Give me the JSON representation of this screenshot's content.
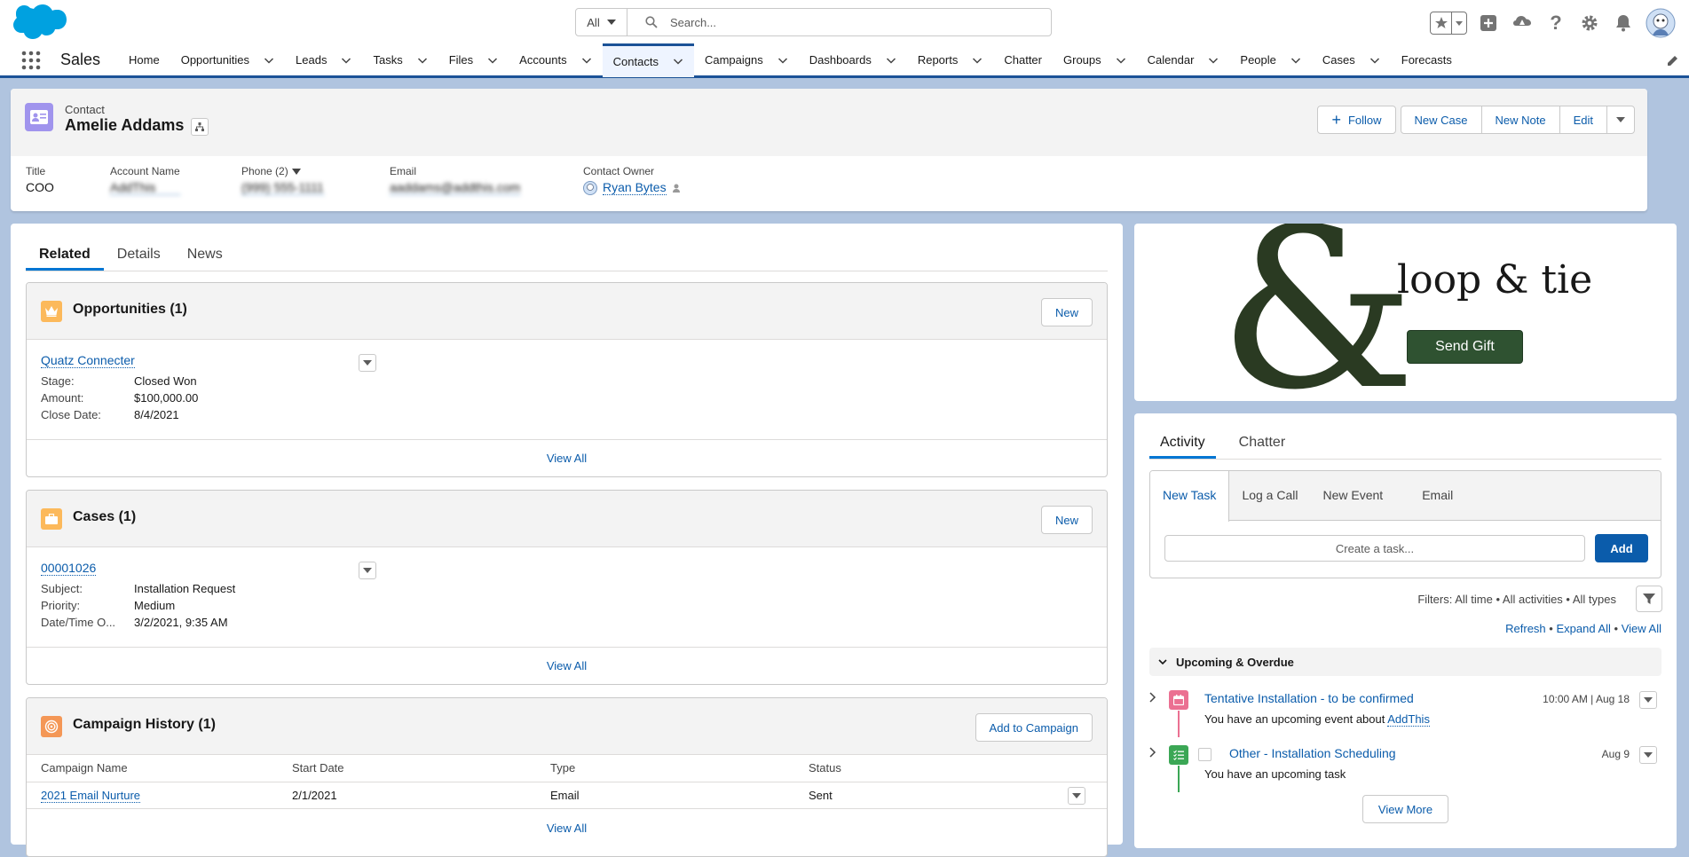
{
  "header": {
    "search_scope": "All",
    "search_placeholder": "Search..."
  },
  "nav": {
    "app_name": "Sales",
    "items": [
      {
        "label": "Home",
        "menu": false
      },
      {
        "label": "Opportunities",
        "menu": true
      },
      {
        "label": "Leads",
        "menu": true
      },
      {
        "label": "Tasks",
        "menu": true
      },
      {
        "label": "Files",
        "menu": true
      },
      {
        "label": "Accounts",
        "menu": true
      },
      {
        "label": "Contacts",
        "menu": true,
        "active": true
      },
      {
        "label": "Campaigns",
        "menu": true
      },
      {
        "label": "Dashboards",
        "menu": true
      },
      {
        "label": "Reports",
        "menu": true
      },
      {
        "label": "Chatter",
        "menu": false
      },
      {
        "label": "Groups",
        "menu": true
      },
      {
        "label": "Calendar",
        "menu": true
      },
      {
        "label": "People",
        "menu": true
      },
      {
        "label": "Cases",
        "menu": true
      },
      {
        "label": "Forecasts",
        "menu": false
      }
    ]
  },
  "record": {
    "type_label": "Contact",
    "name": "Amelie Addams",
    "actions": {
      "follow": "Follow",
      "new_case": "New Case",
      "new_note": "New Note",
      "edit": "Edit"
    },
    "fields": {
      "title_label": "Title",
      "title_value": "COO",
      "account_label": "Account Name",
      "account_value": "AddThis",
      "phone_label": "Phone (2)",
      "phone_value": "(999) 555-1111",
      "email_label": "Email",
      "email_value": "aaddams@addthis.com",
      "owner_label": "Contact Owner",
      "owner_value": "Ryan Bytes"
    }
  },
  "main_tabs": {
    "related": "Related",
    "details": "Details",
    "news": "News"
  },
  "opportunities": {
    "title": "Opportunities (1)",
    "new_label": "New",
    "record_name": "Quatz Connecter",
    "stage_label": "Stage:",
    "stage_value": "Closed Won",
    "amount_label": "Amount:",
    "amount_value": "$100,000.00",
    "close_label": "Close Date:",
    "close_value": "8/4/2021",
    "view_all": "View All"
  },
  "cases": {
    "title": "Cases (1)",
    "new_label": "New",
    "record_name": "00001026",
    "subject_label": "Subject:",
    "subject_value": "Installation Request",
    "priority_label": "Priority:",
    "priority_value": "Medium",
    "datetime_label": "Date/Time O...",
    "datetime_value": "3/2/2021, 9:35 AM",
    "view_all": "View All"
  },
  "campaigns": {
    "title": "Campaign History (1)",
    "add_label": "Add to Campaign",
    "columns": [
      "Campaign Name",
      "Start Date",
      "Type",
      "Status"
    ],
    "rows": [
      {
        "name": "2021 Email Nurture",
        "start": "2/1/2021",
        "type": "Email",
        "status": "Sent"
      }
    ],
    "view_all": "View All"
  },
  "gift": {
    "logo_glyph": "&",
    "brand": "loop & tie",
    "button": "Send Gift",
    "brand_color": "#2f5231"
  },
  "activity": {
    "tabs": {
      "activity": "Activity",
      "chatter": "Chatter"
    },
    "composer_tabs": {
      "new_task": "New Task",
      "log_call": "Log a Call",
      "new_event": "New Event",
      "email": "Email"
    },
    "task_placeholder": "Create a task...",
    "add_label": "Add",
    "filters": "Filters: All time • All activities • All types",
    "refresh": "Refresh",
    "expand_all": "Expand All",
    "view_all": "View All",
    "section": "Upcoming & Overdue",
    "items": [
      {
        "title": "Tentative Installation - to be confirmed",
        "sub_prefix": "You have an upcoming event about ",
        "sub_link": "AddThis",
        "date": "10:00 AM | Aug 18",
        "icon": "calendar-icon",
        "color": "#eb7092"
      },
      {
        "title": "Other - Installation Scheduling",
        "sub_prefix": "You have an upcoming task",
        "sub_link": "",
        "date": "Aug 9",
        "icon": "task-icon",
        "color": "#3ba755"
      }
    ],
    "view_more": "View More"
  }
}
